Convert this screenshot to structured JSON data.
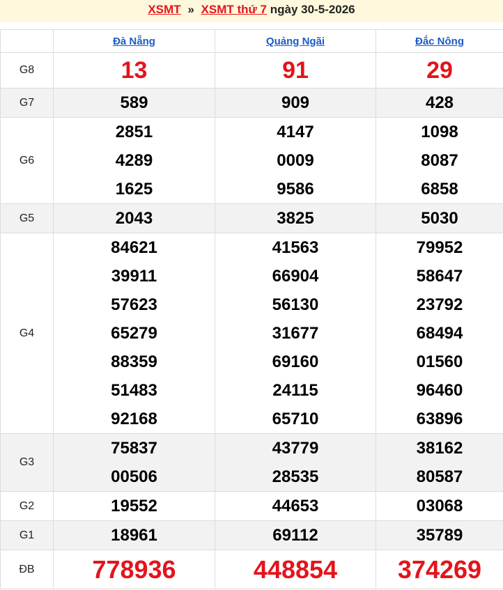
{
  "header": {
    "link1": "XSMT",
    "sep": "»",
    "link2": "XSMT thứ 7",
    "date_text": "ngày 30-5-2026"
  },
  "columns": [
    "Đà Nẵng",
    "Quảng Ngãi",
    "Đắc Nông"
  ],
  "rows": [
    {
      "label": "G8",
      "values": [
        [
          "13"
        ],
        [
          "91"
        ],
        [
          "29"
        ]
      ]
    },
    {
      "label": "G7",
      "values": [
        [
          "589"
        ],
        [
          "909"
        ],
        [
          "428"
        ]
      ]
    },
    {
      "label": "G6",
      "values": [
        [
          "2851",
          "4289",
          "1625"
        ],
        [
          "4147",
          "0009",
          "9586"
        ],
        [
          "1098",
          "8087",
          "6858"
        ]
      ]
    },
    {
      "label": "G5",
      "values": [
        [
          "2043"
        ],
        [
          "3825"
        ],
        [
          "5030"
        ]
      ]
    },
    {
      "label": "G4",
      "values": [
        [
          "84621",
          "39911",
          "57623",
          "65279",
          "88359",
          "51483",
          "92168"
        ],
        [
          "41563",
          "66904",
          "56130",
          "31677",
          "69160",
          "24115",
          "65710"
        ],
        [
          "79952",
          "58647",
          "23792",
          "68494",
          "01560",
          "96460",
          "63896"
        ]
      ]
    },
    {
      "label": "G3",
      "values": [
        [
          "75837",
          "00506"
        ],
        [
          "43779",
          "28535"
        ],
        [
          "38162",
          "80587"
        ]
      ]
    },
    {
      "label": "G2",
      "values": [
        [
          "19552"
        ],
        [
          "44653"
        ],
        [
          "03068"
        ]
      ]
    },
    {
      "label": "G1",
      "values": [
        [
          "18961"
        ],
        [
          "69112"
        ],
        [
          "35789"
        ]
      ]
    },
    {
      "label": "ĐB",
      "values": [
        [
          "778936"
        ],
        [
          "448854"
        ],
        [
          "374269"
        ]
      ]
    }
  ],
  "colors": {
    "accent_red": "#e4141c",
    "link_blue": "#1a5cc8",
    "header_bg": "#fff8dc",
    "shade_bg": "#f2f2f2"
  }
}
